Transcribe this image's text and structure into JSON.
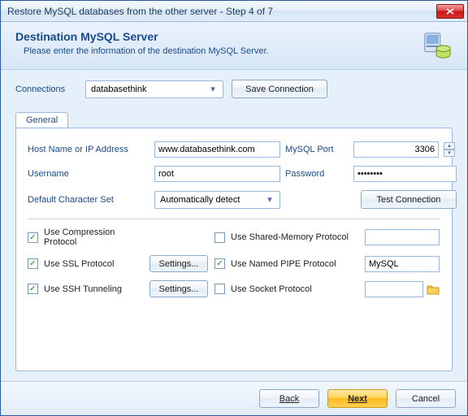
{
  "window": {
    "title": "Restore MySQL databases from the other server - Step 4 of 7"
  },
  "header": {
    "title": "Destination MySQL Server",
    "subtitle": "Please enter the information of the destination MySQL Server."
  },
  "connections": {
    "label": "Connections",
    "selected": "databasethink",
    "save_button": "Save Connection"
  },
  "tabs": {
    "general": "General"
  },
  "form": {
    "host_label": "Host Name or IP Address",
    "host_value": "www.databasethink.com",
    "port_label": "MySQL Port",
    "port_value": "3306",
    "user_label": "Username",
    "user_value": "root",
    "pass_label": "Password",
    "pass_value": "••••••••",
    "charset_label": "Default Character Set",
    "charset_value": "Automatically detect",
    "test_button": "Test Connection"
  },
  "options": {
    "compression": {
      "label": "Use Compression Protocol",
      "checked": true
    },
    "ssl": {
      "label": "Use SSL Protocol",
      "checked": true,
      "settings": "Settings..."
    },
    "ssh": {
      "label": "Use SSH Tunneling",
      "checked": true,
      "settings": "Settings..."
    },
    "shared_mem": {
      "label": "Use Shared-Memory Protocol",
      "checked": false,
      "value": ""
    },
    "named_pipe": {
      "label": "Use Named PIPE Protocol",
      "checked": true,
      "value": "MySQL"
    },
    "socket": {
      "label": "Use Socket Protocol",
      "checked": false,
      "value": ""
    }
  },
  "footer": {
    "back": "Back",
    "next": "Next",
    "cancel": "Cancel"
  }
}
